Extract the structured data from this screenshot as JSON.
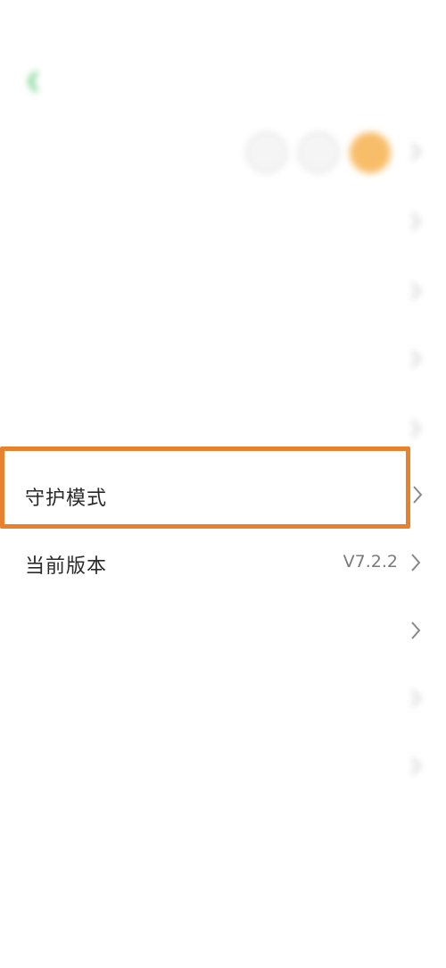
{
  "status_bar": {
    "time": "",
    "right": ""
  },
  "header": {
    "title": ""
  },
  "rows": [
    {
      "label": ""
    },
    {
      "label": ""
    },
    {
      "label": ""
    },
    {
      "label": ""
    },
    {
      "label": ""
    },
    {
      "label": "守护模式"
    },
    {
      "label": "当前版本",
      "value": "V7.2.2"
    },
    {
      "label": ""
    },
    {
      "label": ""
    },
    {
      "label": ""
    }
  ],
  "logout_label": "",
  "colors": {
    "accent": "#3fbf5f",
    "highlight": "#e8812c",
    "avatar_orange": "#f7b24f"
  }
}
